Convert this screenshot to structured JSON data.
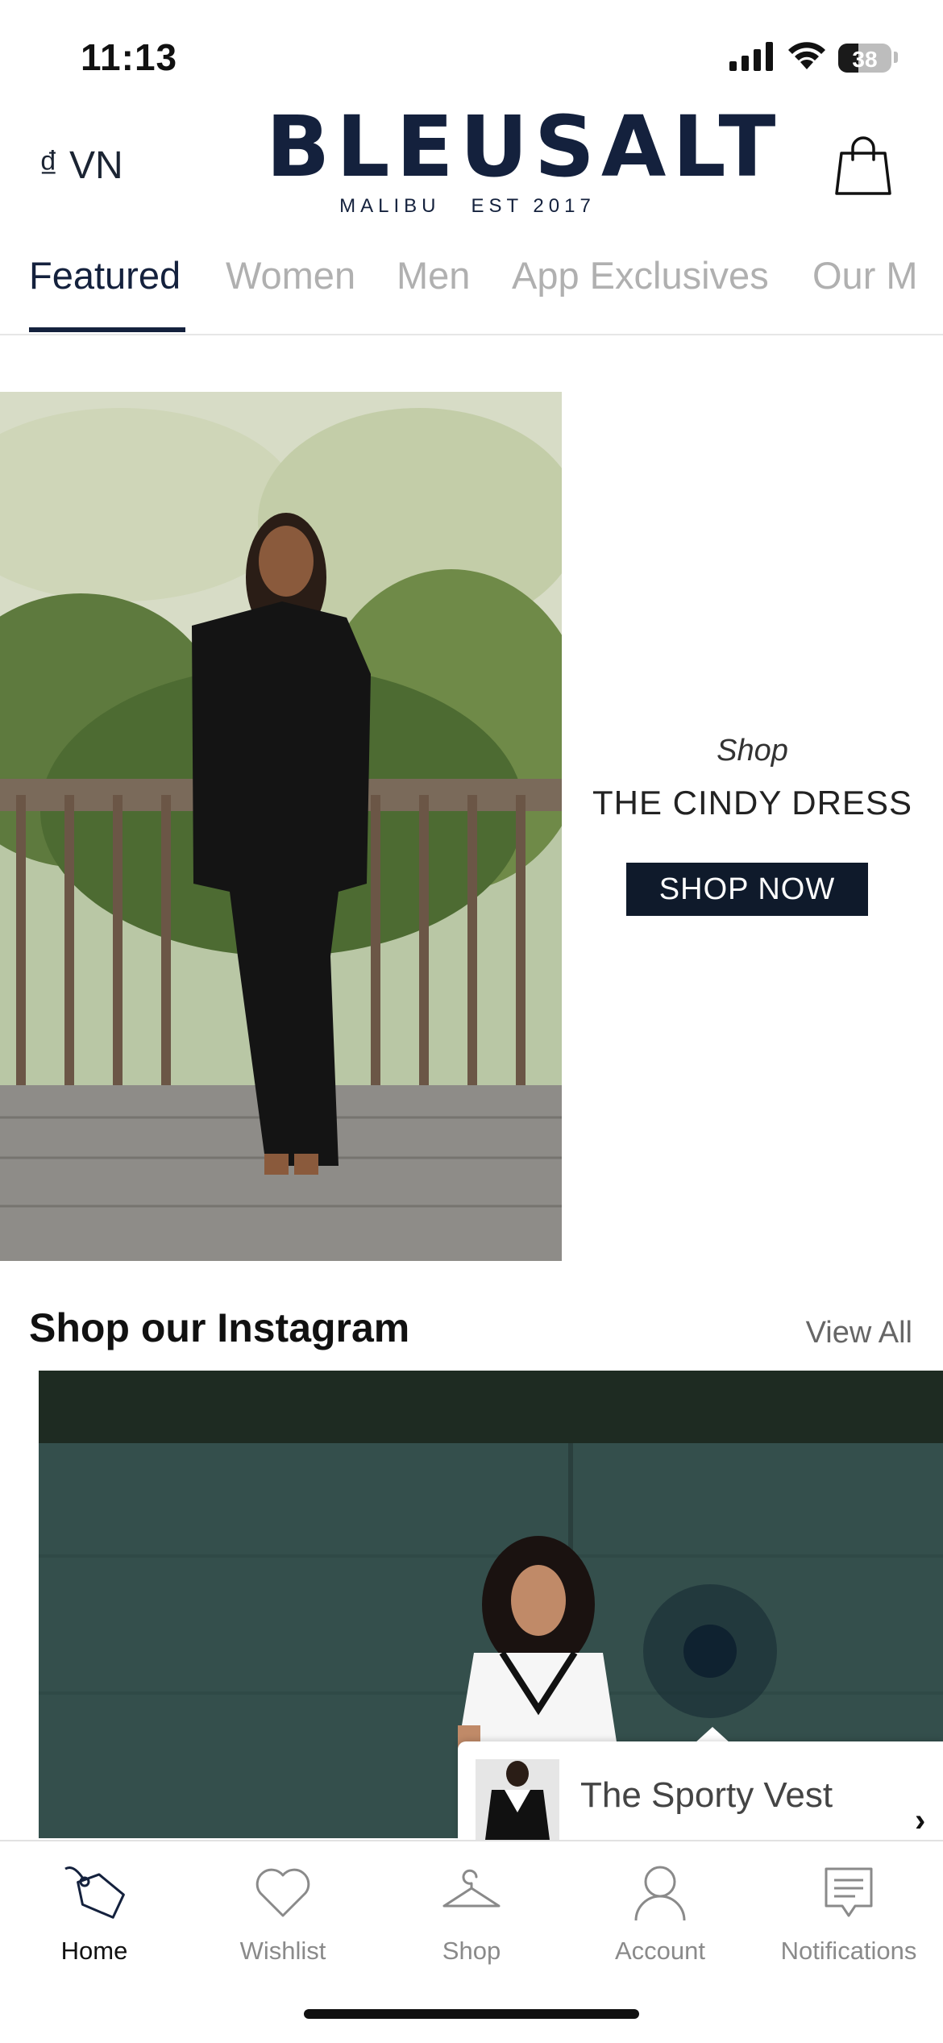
{
  "status_bar": {
    "time": "11:13",
    "battery": "38",
    "battery_level": 0.38
  },
  "header": {
    "currency": "₫ VN",
    "logo_main": "BLEUSALT",
    "logo_sub": "MALIBU   EST 2017",
    "bag_icon": "shopping-bag-icon"
  },
  "tabs": [
    {
      "label": "Featured",
      "active": true
    },
    {
      "label": "Women"
    },
    {
      "label": "Men"
    },
    {
      "label": "App Exclusives"
    },
    {
      "label": "Our M"
    }
  ],
  "banner": {
    "shop_label": "Shop",
    "title": "THE CINDY DRESS",
    "cta": "SHOP NOW"
  },
  "instagram": {
    "title": "Shop our Instagram",
    "view_all": "View All",
    "product_name": "The Sporty Vest",
    "chevron": "›"
  },
  "bottom_nav": [
    {
      "label": "Home",
      "icon": "tag-icon",
      "active": true
    },
    {
      "label": "Wishlist",
      "icon": "heart-icon"
    },
    {
      "label": "Shop",
      "icon": "hanger-icon"
    },
    {
      "label": "Account",
      "icon": "user-icon"
    },
    {
      "label": "Notifications",
      "icon": "message-icon"
    }
  ],
  "colors": {
    "brand": "#14213d",
    "cta_bg": "#0f1a2b",
    "inactive": "#8a8a8a"
  }
}
